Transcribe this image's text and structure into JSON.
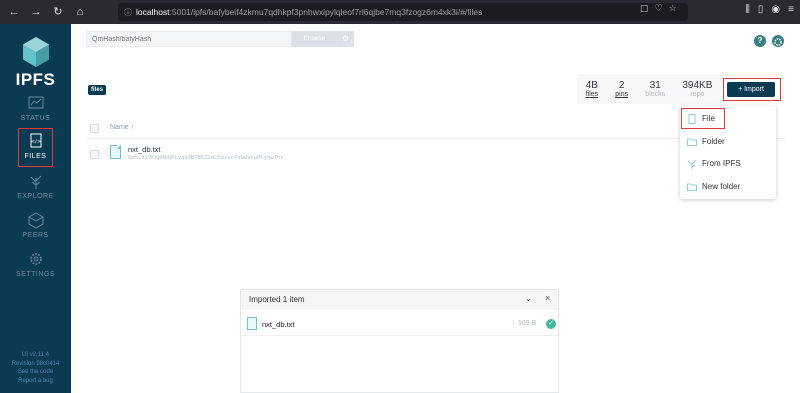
{
  "browser": {
    "url_host": "localhost",
    "url_path": ":5001/ipfs/bafybeif4zkmu7qdhkpf3pnhwxipylqleof7rl6qjbe7mq3fzogz6m4xk3i/#/files"
  },
  "sidebar": {
    "logo": "IPFS",
    "items": [
      {
        "label": "STATUS"
      },
      {
        "label": "FILES"
      },
      {
        "label": "EXPLORE"
      },
      {
        "label": "PEERS"
      },
      {
        "label": "SETTINGS"
      }
    ],
    "footer": [
      "UI v2.11.4",
      "Revision 98c0414",
      "See the code",
      "Report a bug"
    ]
  },
  "header": {
    "search_placeholder": "QmHash/bafyHash",
    "browse_label": "Browse",
    "help_label": "?"
  },
  "main": {
    "breadcrumb": "files",
    "stats": [
      {
        "value": "4B",
        "unit": "files"
      },
      {
        "value": "2",
        "unit": "pins"
      },
      {
        "value": "31",
        "unit": "blocks"
      },
      {
        "value": "394KB",
        "unit": "repo"
      }
    ],
    "import_label": "+ Import",
    "column_name": "Name ↑",
    "files": [
      {
        "name": "nxt_db.txt",
        "hash": "QmSs8sVKdpMbGPLyqsXBTBEZ2dL5azycPxbdvruMtyqwThs"
      }
    ]
  },
  "dropdown": {
    "items": [
      "File",
      "Folder",
      "From IPFS",
      "New folder"
    ]
  },
  "import_panel": {
    "title": "Imported 1 item",
    "file_name": "nxt_db.txt",
    "file_size": "169 B"
  },
  "colors": {
    "sidebar_bg": "#0b3a53",
    "accent_teal": "#378085",
    "success_green": "#46b89a",
    "highlight_red": "#e23a3a"
  }
}
